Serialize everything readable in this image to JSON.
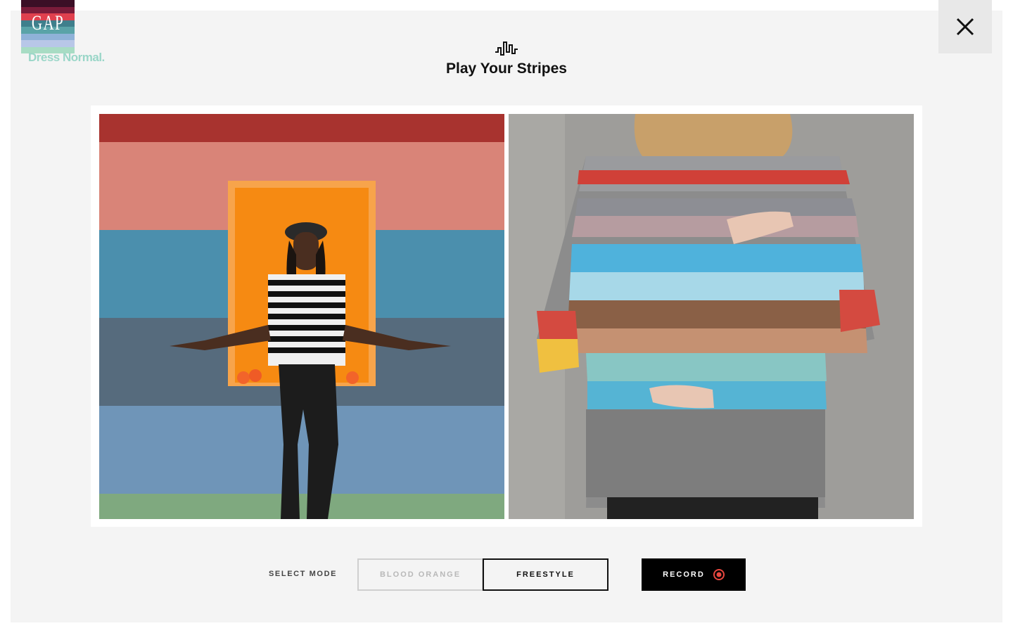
{
  "brand": {
    "logo_text": "GAP",
    "tagline": "Dress Normal.",
    "logo_stripe_colors": [
      "#3b0f26",
      "#7a1c3a",
      "#e0404e",
      "#3f7f8c",
      "#5aa3a8",
      "#8fb2d8",
      "#b8c7e8",
      "#a8dcc4"
    ]
  },
  "header": {
    "icon": "soundwave-icon",
    "title": "Play Your Stripes"
  },
  "close": {
    "icon": "close-icon"
  },
  "stage": {
    "left_pane": {
      "description_icon": "dancer-video"
    },
    "right_pane": {
      "description_icon": "webcam-sweater-feed"
    }
  },
  "controls": {
    "select_mode_label": "SELECT MODE",
    "modes": [
      {
        "label": "BLOOD ORANGE",
        "selected": false
      },
      {
        "label": "FREESTYLE",
        "selected": true
      }
    ],
    "record_label": "RECORD",
    "record_icon": "record-icon",
    "record_icon_color": "#e8473f"
  },
  "colors": {
    "panel_bg": "#f4f4f4",
    "accent_black": "#000000"
  }
}
